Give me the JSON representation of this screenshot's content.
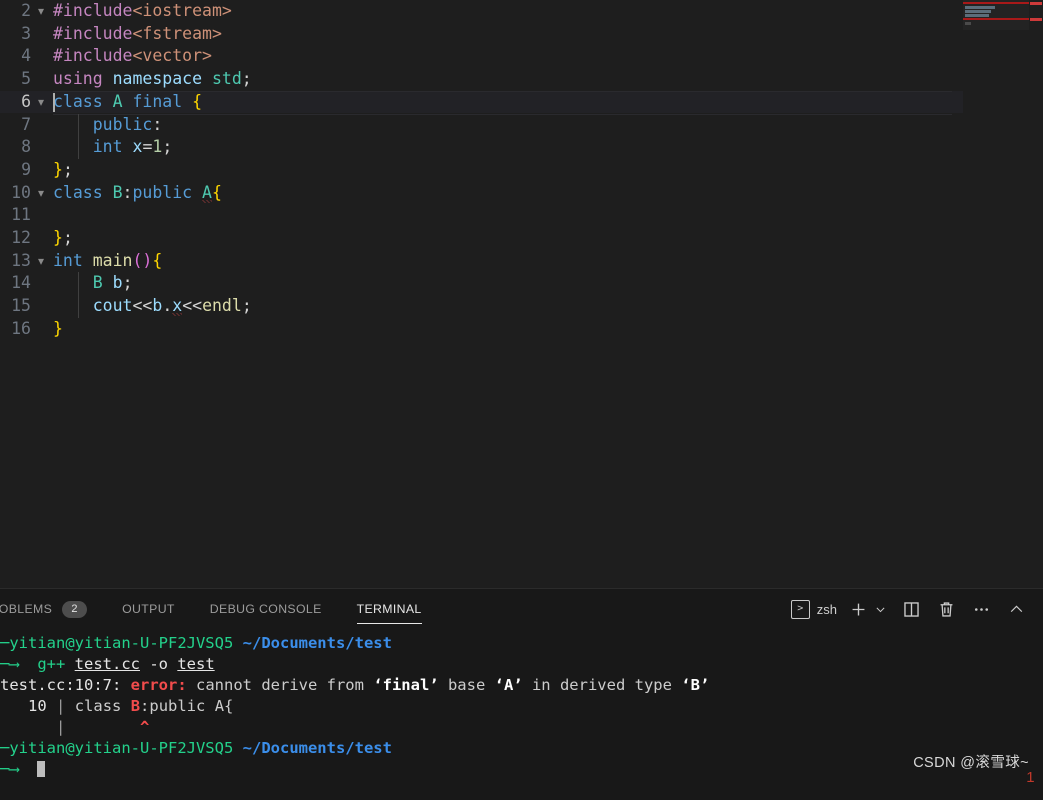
{
  "editor": {
    "first_visible_line": 2,
    "active_line": 6,
    "lines": [
      {
        "num": "2",
        "fold": "chevron-down",
        "text": "#include<iostream>"
      },
      {
        "num": "3",
        "fold": "",
        "text": "#include<fstream>"
      },
      {
        "num": "4",
        "fold": "",
        "text": "#include<vector>"
      },
      {
        "num": "5",
        "fold": "",
        "text": "using namespace std;"
      },
      {
        "num": "6",
        "fold": "chevron-down",
        "text": "class A final {"
      },
      {
        "num": "7",
        "fold": "",
        "text": "    public:"
      },
      {
        "num": "8",
        "fold": "",
        "text": "    int x=1;"
      },
      {
        "num": "9",
        "fold": "",
        "text": "};"
      },
      {
        "num": "10",
        "fold": "chevron-down",
        "text": "class B:public A{"
      },
      {
        "num": "11",
        "fold": "",
        "text": ""
      },
      {
        "num": "12",
        "fold": "",
        "text": "};"
      },
      {
        "num": "13",
        "fold": "chevron-down",
        "text": "int main(){"
      },
      {
        "num": "14",
        "fold": "",
        "text": "    B b;"
      },
      {
        "num": "15",
        "fold": "",
        "text": "    cout<<b.x<<endl;"
      },
      {
        "num": "16",
        "fold": "",
        "text": "}"
      }
    ]
  },
  "panel": {
    "tabs": [
      {
        "label": "PROBLEMS",
        "badge": "2",
        "active": false
      },
      {
        "label": "OUTPUT",
        "badge": "",
        "active": false
      },
      {
        "label": "DEBUG CONSOLE",
        "badge": "",
        "active": false
      },
      {
        "label": "TERMINAL",
        "badge": "",
        "active": true
      }
    ],
    "actions": {
      "shell_name": "zsh",
      "terminal_icon": "terminal-icon",
      "new_terminal": "plus-icon",
      "new_terminal_dropdown": "chevron-down-icon",
      "split_terminal": "split-editor-icon",
      "kill_terminal": "trash-icon",
      "more_actions": "ellipsis-icon",
      "hide_panel": "chevron-up-icon"
    }
  },
  "terminal": {
    "prompt_user_host": "yitian@yitian-U-PF2JVSQ5",
    "prompt_path": "~/Documents/test",
    "lines": [
      {
        "kind": "prompt"
      },
      {
        "kind": "command",
        "command": "g++ test.cc -o test"
      },
      {
        "kind": "error_head",
        "location": "test.cc:10:7:",
        "severity": "error:",
        "message_pre": " cannot derive from ",
        "final_q": "‘final’",
        "base_mid": " base ",
        "base_q": "‘A’",
        "derived_mid": " in derived type ",
        "derived_q": "‘B’"
      },
      {
        "kind": "error_source",
        "lineno": "10",
        "bar": "|",
        "code_pre": "class ",
        "code_hl": "B",
        "code_post": ":public A{"
      },
      {
        "kind": "error_caret",
        "bar": "|",
        "caret": "^"
      },
      {
        "kind": "prompt"
      },
      {
        "kind": "input"
      }
    ]
  },
  "watermark": {
    "text": "CSDN @滚雪球~",
    "number": "1"
  },
  "colors": {
    "editor_bg": "#1e1e1e",
    "panel_bg": "#181818",
    "error_red": "#f14c4c",
    "prompt_green": "#23d18b",
    "path_blue": "#3b8eea"
  }
}
